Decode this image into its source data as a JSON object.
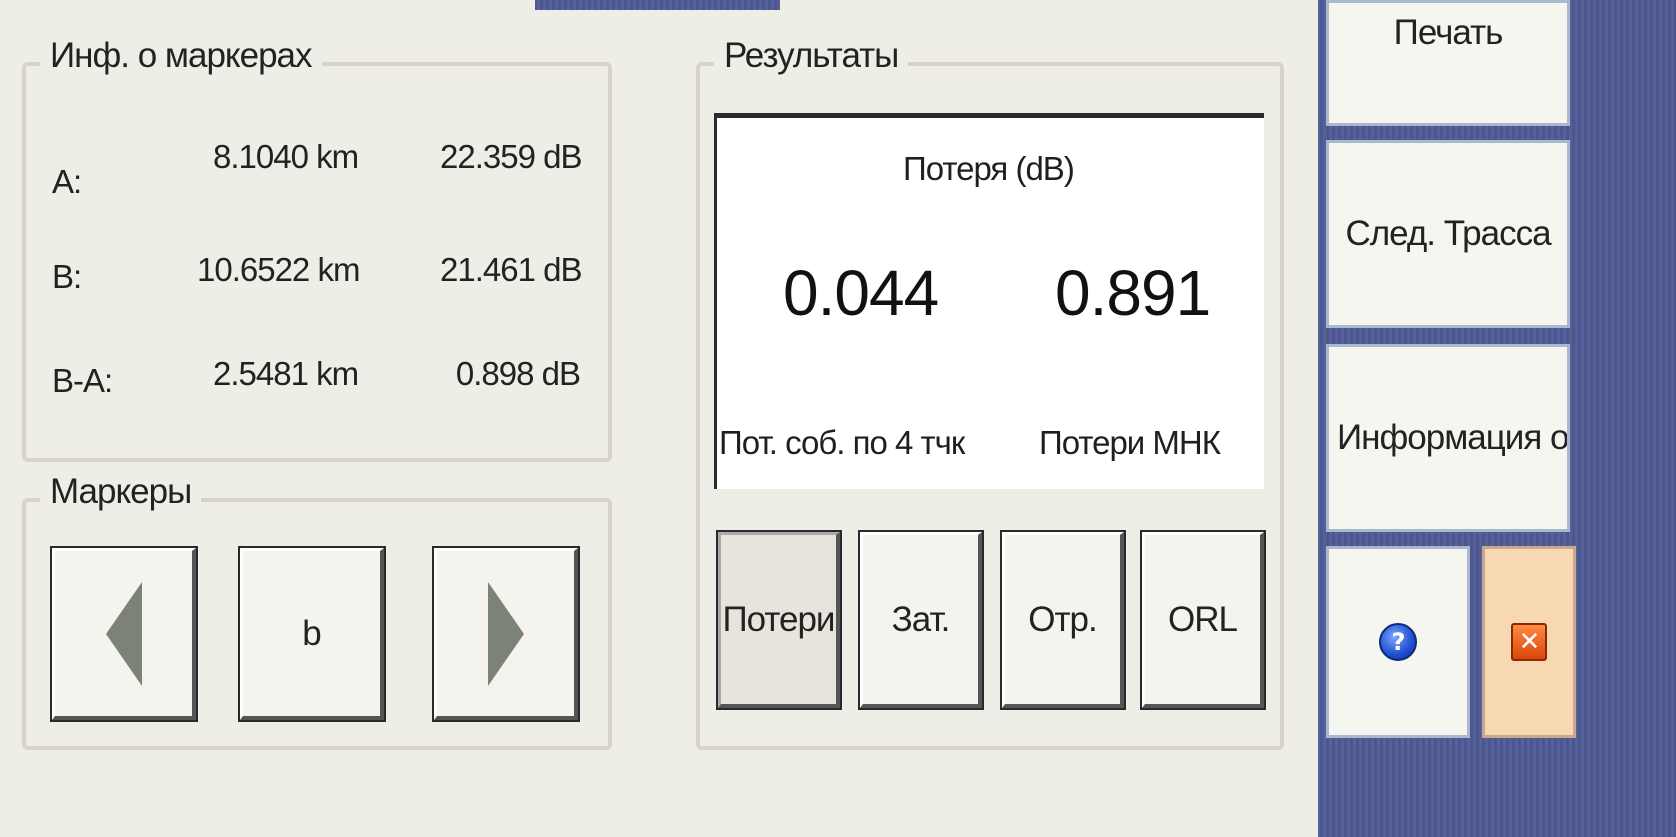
{
  "marker_info": {
    "title": "Инф. о маркерах",
    "rows": [
      {
        "label": "A:",
        "distance": "8.1040 km",
        "level": "22.359 dB"
      },
      {
        "label": "B:",
        "distance": "10.6522 km",
        "level": "21.461 dB"
      },
      {
        "label": "B-A:",
        "distance": "2.5481 km",
        "level": "0.898 dB"
      }
    ]
  },
  "markers": {
    "title": "Маркеры",
    "center_label": "b",
    "prev_icon": "arrow-left-icon",
    "next_icon": "arrow-right-icon"
  },
  "results": {
    "title": "Результаты",
    "header": "Потеря (dB)",
    "value_left": "0.044",
    "value_right": "0.891",
    "label_left": "Пот. соб. по 4 тчк",
    "label_right": "Потери МНК",
    "tabs": [
      "Потери",
      "Зат.",
      "Отр.",
      "ORL"
    ],
    "active_tab": "Потери"
  },
  "sidebar": {
    "print_label": "Печать",
    "next_trace_label": "След. Трасса",
    "info_label": "Информация о",
    "help_icon": "help-icon",
    "close_icon": "close-icon"
  },
  "colors": {
    "background": "#4f5a92",
    "panel": "#efeee6",
    "close_button": "#f8d7b3"
  }
}
